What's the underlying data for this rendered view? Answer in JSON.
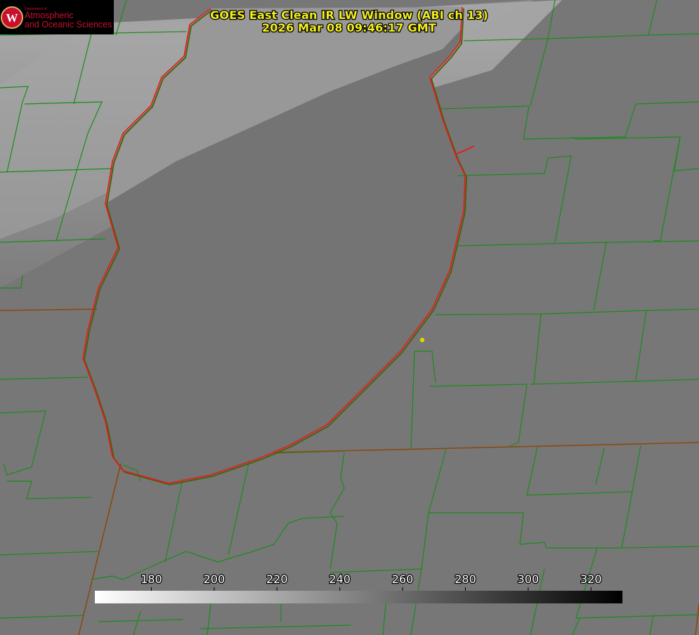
{
  "title": {
    "line1": "GOES East Clean IR LW Window (ABI ch 13)",
    "line2": "2026 Mar 08 09:46:17 GMT"
  },
  "logo": {
    "department": "Department of",
    "line1": "Atmospheric",
    "line2": "and Oceanic Sciences",
    "seal_letter": "W"
  },
  "colorbar": {
    "ticks": [
      "180",
      "200",
      "220",
      "240",
      "260",
      "280",
      "300",
      "320"
    ],
    "min_value": 162,
    "max_value": 330,
    "gradient_start": "#ffffff",
    "gradient_end": "#000000"
  },
  "map": {
    "county_line_color": "#1a8c1a",
    "state_line_color": "#8a4a10",
    "coastline_color": "#e81a1a",
    "marker_color": "#d8d800"
  }
}
